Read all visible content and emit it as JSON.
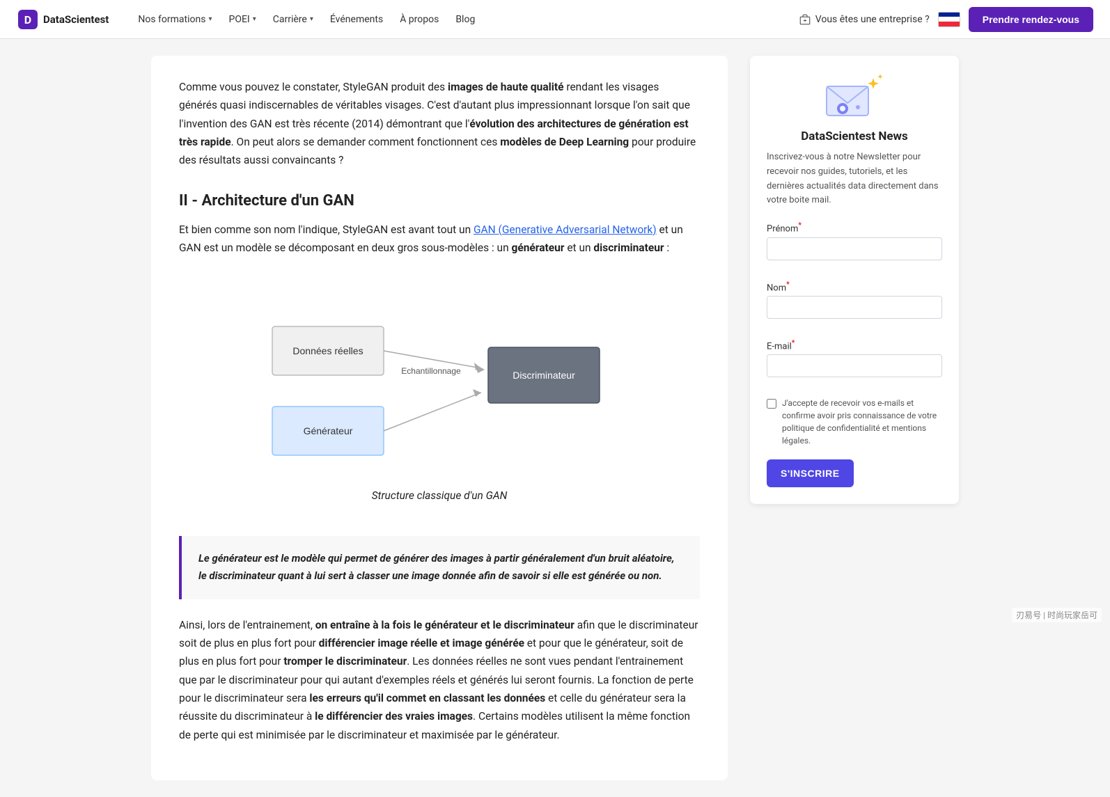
{
  "navbar": {
    "logo_text": "DataScientest",
    "nav_items": [
      {
        "label": "Nos formations",
        "has_chevron": true
      },
      {
        "label": "POEI",
        "has_chevron": true
      },
      {
        "label": "Carrière",
        "has_chevron": true
      },
      {
        "label": "Événements",
        "has_chevron": false
      },
      {
        "label": "À propos",
        "has_chevron": false
      },
      {
        "label": "Blog",
        "has_chevron": false
      }
    ],
    "enterprise_label": "Vous êtes une entreprise ?",
    "cta_label": "Prendre rendez-vous"
  },
  "article": {
    "intro_p1_start": "Comme vous pouvez le constater, StyleGAN produit des ",
    "intro_p1_bold1": "images de haute qualité",
    "intro_p1_mid": " rendant les visages générés quasi indiscernables de véritables visages. C'est d'autant plus impressionnant lorsque l'on sait que l'invention des GAN est très récente (2014) démontrant que l'",
    "intro_p1_bold2": "évolution des architectures de génération est très rapide",
    "intro_p1_end": ". On peut alors se demander comment fonctionnent ces ",
    "intro_p1_bold3": "modèles de Deep Learning",
    "intro_p1_last": " pour produire des résultats aussi convaincants ?",
    "section2_title": "II - Architecture d'un GAN",
    "section2_p1_start": "Et bien comme son nom l'indique, StyleGAN est avant tout un ",
    "section2_p1_link": "GAN (Generative Adversarial Network)",
    "section2_p1_mid": " et un GAN est un modèle se décomposant en deux gros sous-modèles : un ",
    "section2_p1_bold1": "générateur",
    "section2_p1_connector": " et un ",
    "section2_p1_bold2": "discriminateur",
    "section2_p1_end": " :",
    "diagram_caption": "Structure classique d'un GAN",
    "diagram": {
      "box1_label": "Données réelles",
      "arrow_label": "Echantillonnage",
      "box2_label": "Discriminateur",
      "box3_label": "Générateur"
    },
    "quote": "Le générateur est le modèle qui permet de générer des images à partir généralement d'un bruit aléatoire, le discriminateur quant à lui sert à classer une image donnée afin de savoir si elle est générée ou non.",
    "body_p1_start": "Ainsi, lors de l'entrainement, ",
    "body_p1_bold1": "on entraîne à la fois le générateur et le discriminateur",
    "body_p1_mid": " afin que le discriminateur soit de plus en plus fort pour ",
    "body_p1_bold2": "différencier image réelle et image générée",
    "body_p1_mid2": " et pour que le générateur, soit de plus en plus fort pour ",
    "body_p1_bold3": "tromper le discriminateur",
    "body_p1_mid3": ". Les données réelles ne sont vues pendant l'entrainement que par le discriminateur pour qui autant d'exemples réels et générés lui seront fournis. La fonction de perte pour le discriminateur sera ",
    "body_p1_bold4": "les erreurs qu'il commet en classant les données",
    "body_p1_mid4": " et celle du générateur sera la réussite du discriminateur à ",
    "body_p1_bold5": "le différencier des vraies images",
    "body_p1_end": ". Certains modèles utilisent la même fonction de perte qui est minimisée par le discriminateur et maximisée par le générateur."
  },
  "sidebar": {
    "newsletter": {
      "title": "DataScientest News",
      "description": "Inscrivez-vous à notre Newsletter pour recevoir nos guides, tutoriels, et les dernières actualités data directement dans votre boite mail.",
      "prenom_label": "Prénom",
      "nom_label": "Nom",
      "email_label": "E-mail",
      "checkbox_text": "J'accepte de recevoir vos e-mails et confirme avoir pris connaissance de votre politique de confidentialité et mentions légales.",
      "subscribe_btn": "S'INSCRIRE"
    }
  },
  "watermark": "刃易号 | 时尚玩家岳可"
}
